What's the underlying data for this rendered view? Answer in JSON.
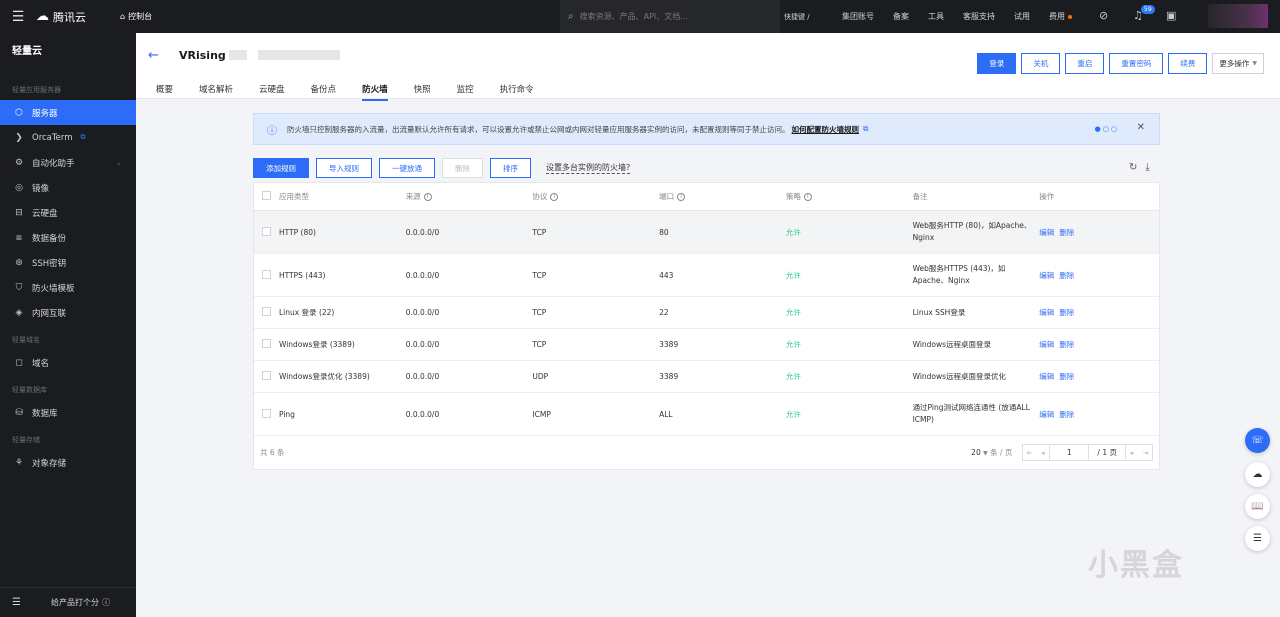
{
  "topbar": {
    "brand": "腾讯云",
    "console": "控制台",
    "search_placeholder": "搜索资源、产品、API、文档...",
    "shortcut": "快捷键 /",
    "links": [
      "集团账号",
      "备案",
      "工具",
      "客服支持",
      "试用",
      "费用"
    ],
    "badge": "59"
  },
  "sidebar": {
    "title": "轻量云",
    "groups": [
      {
        "label": "轻量应用服务器",
        "items": [
          {
            "label": "服务器",
            "icon": "server-icon",
            "active": true
          },
          {
            "label": "OrcaTerm",
            "icon": "terminal-icon",
            "ext": true
          },
          {
            "label": "自动化助手",
            "icon": "robot-icon",
            "chevron": true
          },
          {
            "label": "镜像",
            "icon": "image-icon"
          },
          {
            "label": "云硬盘",
            "icon": "disk-icon"
          },
          {
            "label": "数据备份",
            "icon": "backup-icon"
          },
          {
            "label": "SSH密钥",
            "icon": "key-icon"
          },
          {
            "label": "防火墙模板",
            "icon": "shield-icon"
          },
          {
            "label": "内网互联",
            "icon": "network-icon"
          }
        ]
      },
      {
        "label": "轻量域名",
        "items": [
          {
            "label": "域名",
            "icon": "domain-icon"
          }
        ]
      },
      {
        "label": "轻量数据库",
        "items": [
          {
            "label": "数据库",
            "icon": "database-icon"
          }
        ]
      },
      {
        "label": "轻量存储",
        "items": [
          {
            "label": "对象存储",
            "icon": "storage-icon"
          }
        ]
      }
    ],
    "footer": "给产品打个分"
  },
  "header": {
    "title": "VRising",
    "actions": [
      "登录",
      "关机",
      "重启",
      "重置密码",
      "续费",
      "更多操作"
    ],
    "tabs": [
      "概要",
      "域名解析",
      "云硬盘",
      "备份点",
      "防火墙",
      "快照",
      "监控",
      "执行命令"
    ],
    "active_tab": "防火墙"
  },
  "banner": {
    "text": "防火墙只控制服务器的入流量，出流量默认允许所有请求，可以设置允许或禁止公网或内网对轻量应用服务器实例的访问，未配置规则等同于禁止访问。",
    "link": "如何配置防火墙规则"
  },
  "toolbar": {
    "buttons": [
      "添加规则",
      "导入规则",
      "一键放通",
      "删除",
      "排序"
    ],
    "link": "设置多台实例的防火墙?"
  },
  "table": {
    "headers": [
      "应用类型",
      "来源",
      "协议",
      "端口",
      "策略",
      "备注",
      "操作"
    ],
    "rows": [
      {
        "type": "HTTP (80)",
        "source": "0.0.0.0/0",
        "protocol": "TCP",
        "port": "80",
        "policy": "允许",
        "note": "Web服务HTTP (80)，如Apache、Nginx"
      },
      {
        "type": "HTTPS (443)",
        "source": "0.0.0.0/0",
        "protocol": "TCP",
        "port": "443",
        "policy": "允许",
        "note": "Web服务HTTPS (443)，如Apache、Nginx"
      },
      {
        "type": "Linux 登录 (22)",
        "source": "0.0.0.0/0",
        "protocol": "TCP",
        "port": "22",
        "policy": "允许",
        "note": "Linux SSH登录"
      },
      {
        "type": "Windows登录 (3389)",
        "source": "0.0.0.0/0",
        "protocol": "TCP",
        "port": "3389",
        "policy": "允许",
        "note": "Windows远程桌面登录"
      },
      {
        "type": "Windows登录优化 (3389)",
        "source": "0.0.0.0/0",
        "protocol": "UDP",
        "port": "3389",
        "policy": "允许",
        "note": "Windows远程桌面登录优化"
      },
      {
        "type": "Ping",
        "source": "0.0.0.0/0",
        "protocol": "ICMP",
        "port": "ALL",
        "policy": "允许",
        "note": "通过Ping测试网络连通性 (放通ALL ICMP)"
      }
    ],
    "op_edit": "编辑",
    "op_delete": "删除",
    "total": "共 6 条",
    "page_size": "20",
    "per_page": "条 / 页",
    "page": "1",
    "pages": "/ 1 页"
  },
  "watermark": "小黑盒"
}
